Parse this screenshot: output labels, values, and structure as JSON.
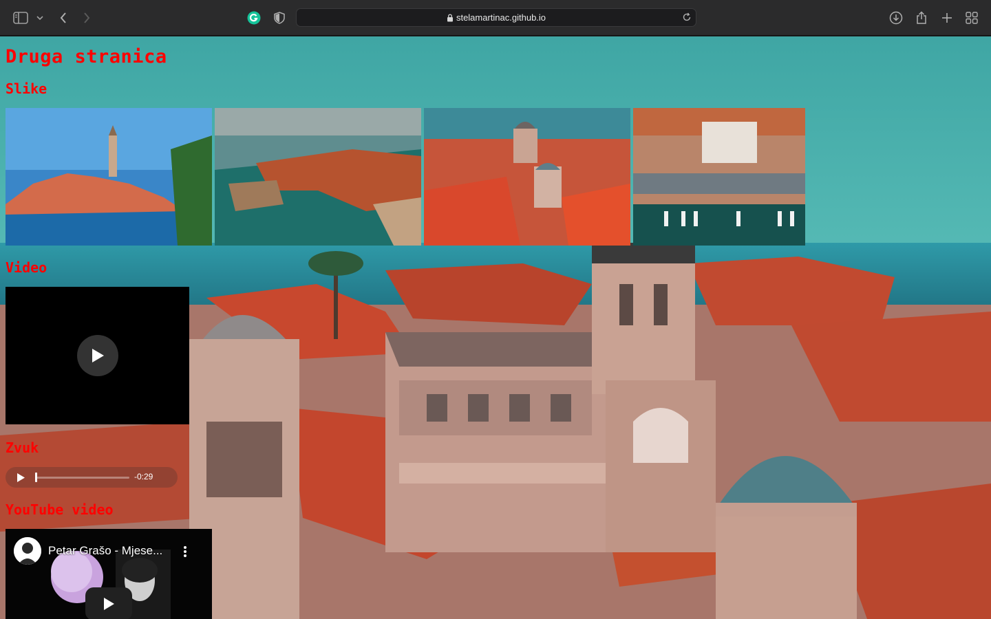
{
  "browser": {
    "url": "stelamartinac.github.io"
  },
  "page": {
    "heading": "Druga stranica",
    "sections": {
      "images": "Slike",
      "video": "Video",
      "audio": "Zvuk",
      "youtube": "YouTube video"
    },
    "audio_player": {
      "time_remaining": "-0:29"
    },
    "youtube_embed": {
      "title": "Petar Grašo - Mjese..."
    }
  }
}
